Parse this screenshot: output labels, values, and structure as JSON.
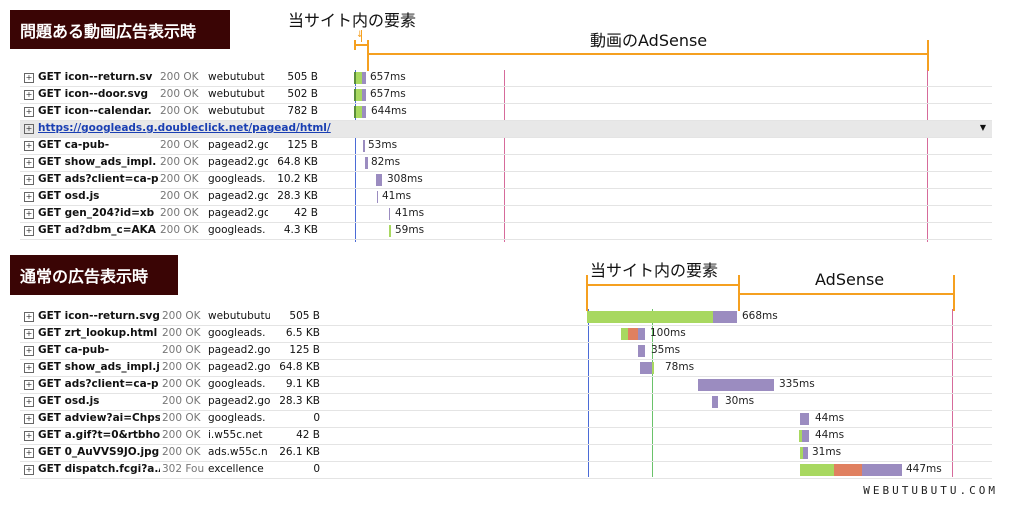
{
  "top_section": {
    "title": "問題ある動画広告表示時",
    "annotation_site": "当サイト内の要素",
    "annotation_adsense": "動画のAdSense",
    "rows": [
      {
        "name": "GET icon--return.sv",
        "status": "200 OK",
        "domain": "webutubut",
        "size": "505 B",
        "time": "657ms"
      },
      {
        "name": "GET icon--door.svg",
        "status": "200 OK",
        "domain": "webutubut",
        "size": "502 B",
        "time": "657ms"
      },
      {
        "name": "GET icon--calendar.",
        "status": "200 OK",
        "domain": "webutubut",
        "size": "782 B",
        "time": "644ms"
      },
      {
        "url": "https://googleads.g.doubleclick.net/pagead/html/"
      },
      {
        "name": "GET ca-pub-",
        "status": "200 OK",
        "domain": "pagead2.go",
        "size": "125 B",
        "time": "53ms"
      },
      {
        "name": "GET show_ads_impl.",
        "status": "200 OK",
        "domain": "pagead2.go",
        "size": "64.8 KB",
        "time": "82ms"
      },
      {
        "name": "GET ads?client=ca-p",
        "status": "200 OK",
        "domain": "googleads.",
        "size": "10.2 KB",
        "time": "308ms"
      },
      {
        "name": "GET osd.js",
        "status": "200 OK",
        "domain": "pagead2.go",
        "size": "28.3 KB",
        "time": "41ms"
      },
      {
        "name": "GET gen_204?id=xb",
        "status": "200 OK",
        "domain": "pagead2.go",
        "size": "42 B",
        "time": "41ms"
      },
      {
        "name": "GET ad?dbm_c=AKA",
        "status": "200 OK",
        "domain": "googleads.",
        "size": "4.3 KB",
        "time": "59ms"
      }
    ]
  },
  "bottom_section": {
    "title": "通常の広告表示時",
    "annotation_site": "当サイト内の要素",
    "annotation_adsense": "AdSense",
    "rows": [
      {
        "name": "GET icon--return.svg",
        "status": "200 OK",
        "domain": "webutubutu",
        "size": "505 B",
        "time": "668ms"
      },
      {
        "name": "GET zrt_lookup.html",
        "status": "200 OK",
        "domain": "googleads.",
        "size": "6.5 KB",
        "time": "100ms"
      },
      {
        "name": "GET ca-pub-",
        "status": "200 OK",
        "domain": "pagead2.go",
        "size": "125 B",
        "time": "35ms"
      },
      {
        "name": "GET show_ads_impl.j",
        "status": "200 OK",
        "domain": "pagead2.go",
        "size": "64.8 KB",
        "time": "78ms"
      },
      {
        "name": "GET ads?client=ca-p",
        "status": "200 OK",
        "domain": "googleads.",
        "size": "9.1 KB",
        "time": "335ms"
      },
      {
        "name": "GET osd.js",
        "status": "200 OK",
        "domain": "pagead2.go",
        "size": "28.3 KB",
        "time": "30ms"
      },
      {
        "name": "GET adview?ai=Chps",
        "status": "200 OK",
        "domain": "googleads.",
        "size": "0",
        "time": "44ms"
      },
      {
        "name": "GET a.gif?t=0&rtbhos",
        "status": "200 OK",
        "domain": "i.w55c.net",
        "size": "42 B",
        "time": "44ms"
      },
      {
        "name": "GET 0_AuVVS9JO.jpg",
        "status": "200 OK",
        "domain": "ads.w55c.n",
        "size": "26.1 KB",
        "time": "31ms"
      },
      {
        "name": "GET dispatch.fcgi?a.A",
        "status": "302 Fou",
        "domain": "excellence",
        "size": "0",
        "time": "447ms"
      }
    ]
  },
  "footer": "WEBUTUBUTU.COM",
  "colors": {
    "badge": "#3a0505",
    "bracket": "#f5a020",
    "green": "#a8d860",
    "purple": "#9b8cc0",
    "salmon": "#e08060"
  }
}
